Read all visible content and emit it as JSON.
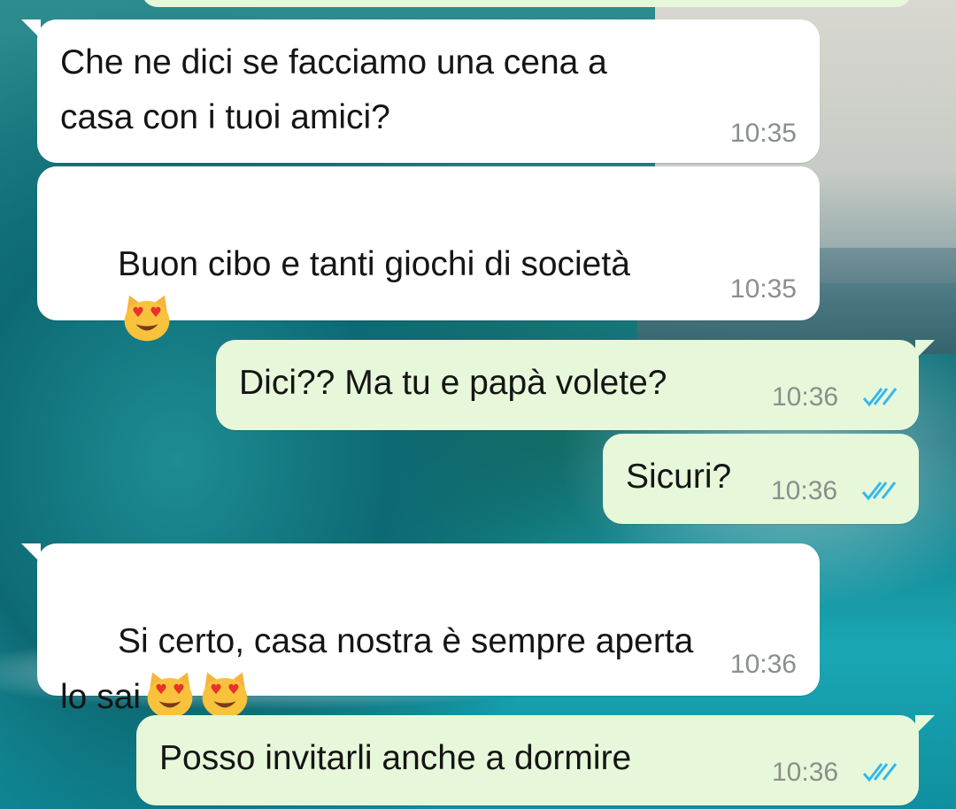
{
  "messages": [
    {
      "id": "m1",
      "direction": "incoming",
      "text": "Che ne dici se facciamo una cena a\ncasa con i tuoi amici?",
      "time": "10:35",
      "emoji_count": 0
    },
    {
      "id": "m2",
      "direction": "incoming",
      "text": "Buon cibo e tanti giochi di società",
      "time": "10:35",
      "emoji": "smiling-cat-heart-eyes",
      "emoji_count": 1
    },
    {
      "id": "m3",
      "direction": "outgoing",
      "text": "Dici?? Ma tu e papà volete?",
      "time": "10:36",
      "status": "read"
    },
    {
      "id": "m4",
      "direction": "outgoing",
      "text": "Sicuri?",
      "time": "10:36",
      "status": "read"
    },
    {
      "id": "m5",
      "direction": "incoming",
      "text": "Si certo, casa nostra è sempre aperta\nlo sai",
      "time": "10:36",
      "emoji": "smiling-cat-heart-eyes",
      "emoji_count": 2
    },
    {
      "id": "m6",
      "direction": "outgoing",
      "text": "Posso invitarli anche a dormire",
      "time": "10:36",
      "status": "read"
    }
  ],
  "colors": {
    "incoming_bubble": "#ffffff",
    "outgoing_bubble": "#e6f8d9",
    "read_tick": "#34b7f1",
    "timestamp": "#8a8f8c"
  }
}
